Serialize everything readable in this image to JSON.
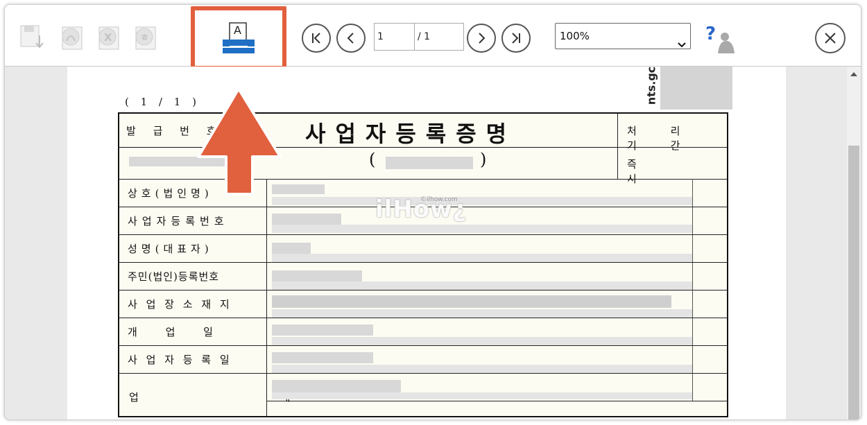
{
  "toolbar": {
    "page_current": "1",
    "page_total": "/ 1",
    "zoom_value": "100%",
    "icons": [
      "save-icon",
      "pdf-icon",
      "excel-icon",
      "hwp-icon",
      "print-icon",
      "first-page-icon",
      "prev-page-icon",
      "next-page-icon",
      "last-page-icon",
      "help-icon",
      "close-icon"
    ],
    "print_letter": "A"
  },
  "document": {
    "page_indicator": "( 1 / 1 )",
    "title": "사업자등록증명",
    "paren_open": "(",
    "paren_close": ")",
    "side_url": "nts.gc",
    "issue_label": "발 급 번 호",
    "processing_label": "처 리 기 간",
    "processing_value": "즉 시",
    "rows": [
      "상호(법인명)",
      "사업자등록번호",
      "성명(대표자)",
      "주민(법인)등록번호",
      "사 업 장 소 재 지",
      "개 업 일",
      "사 업 자 등 록 일",
      "업 태"
    ]
  },
  "watermark": {
    "text": "ilHow¿",
    "small": "©ilhow.com"
  },
  "colors": {
    "highlight": "#e1603d",
    "print_blue": "#1f6fc5"
  }
}
